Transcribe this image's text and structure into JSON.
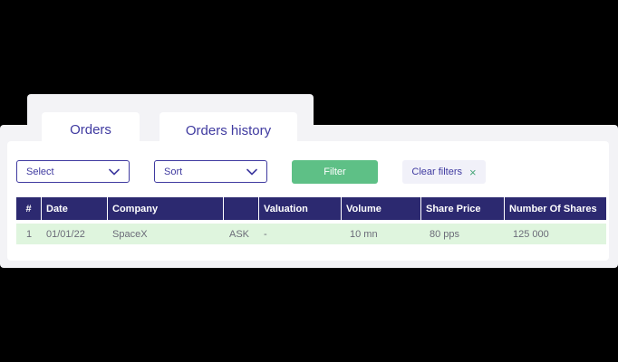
{
  "tabs": {
    "orders": "Orders",
    "history": "Orders history"
  },
  "filters": {
    "select_label": "Select",
    "sort_label": "Sort",
    "filter_label": "Filter",
    "clear_label": "Clear filters",
    "clear_icon": "×"
  },
  "table": {
    "headers": [
      "#",
      "Date",
      "Company",
      "",
      "Valuation",
      "Volume",
      "Share Price",
      "Number Of Shares"
    ],
    "rows": [
      [
        "1",
        "01/01/22",
        "SpaceX",
        "ASK",
        "-",
        "10 mn",
        "80 pps",
        "125 000"
      ]
    ]
  },
  "colors": {
    "accent": "#3f3aa0",
    "header_bg": "#2c2970",
    "filter_green": "#5ec086",
    "row_green": "#dff5de"
  }
}
